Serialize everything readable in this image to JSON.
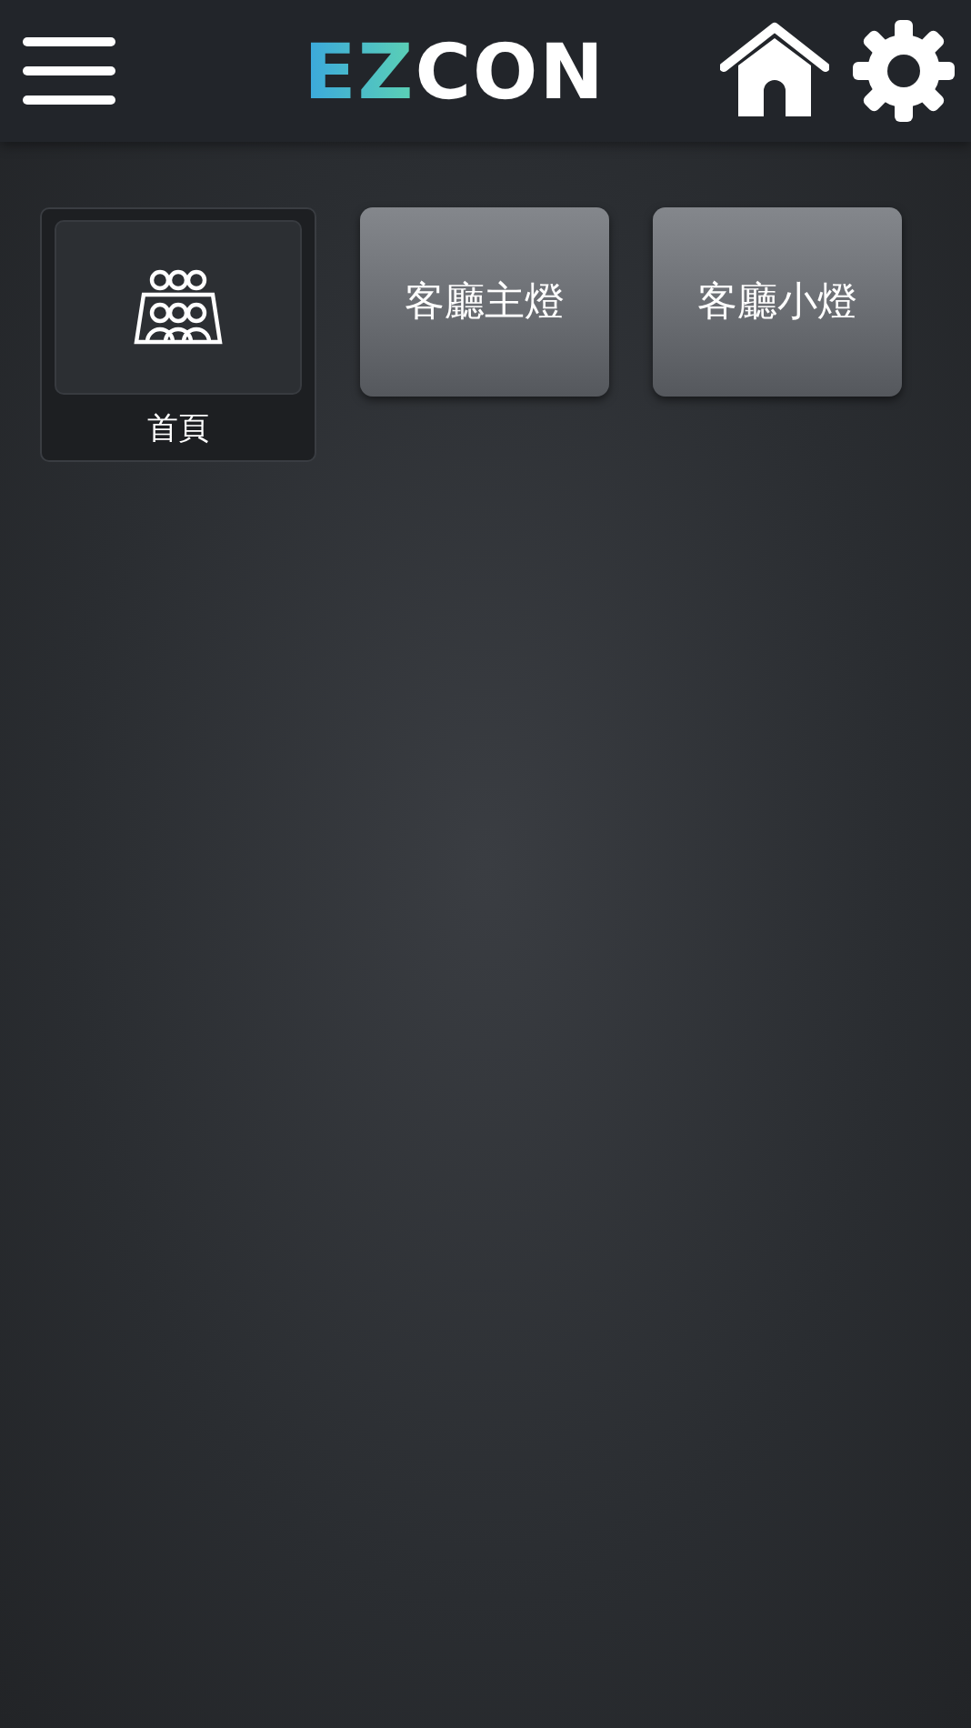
{
  "header": {
    "logo": "EZCON"
  },
  "tiles": [
    {
      "kind": "group",
      "label": "首頁"
    },
    {
      "kind": "button",
      "label": "客廳主燈"
    },
    {
      "kind": "button",
      "label": "客廳小燈"
    }
  ]
}
